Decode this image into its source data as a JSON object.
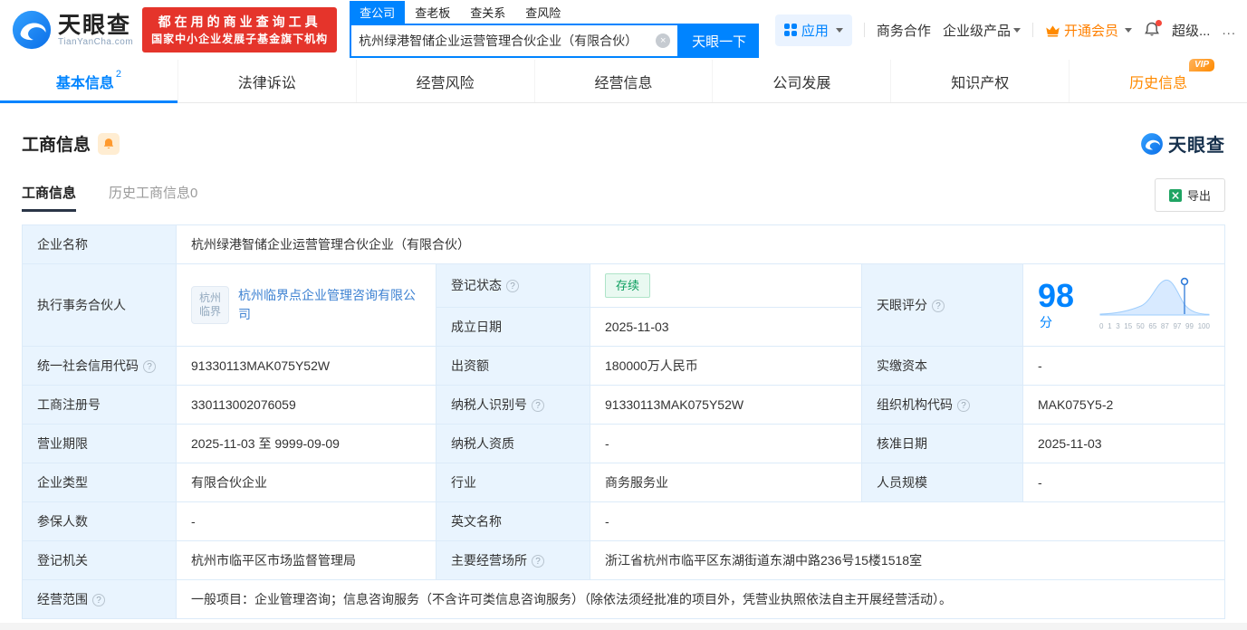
{
  "header": {
    "logo": {
      "title": "天眼查",
      "subtitle": "TianYanCha.com"
    },
    "slogan": {
      "line1": "都在用的商业查询工具",
      "line2": "国家中小企业发展子基金旗下机构"
    },
    "search": {
      "tabs": [
        {
          "label": "查公司"
        },
        {
          "label": "查老板"
        },
        {
          "label": "查关系"
        },
        {
          "label": "查风险"
        }
      ],
      "value": "杭州绿港智储企业运营管理合伙企业（有限合伙）",
      "button": "天眼一下"
    },
    "nav": {
      "apps": "应用",
      "cooperation": "商务合作",
      "enterprise_products": "企业级产品",
      "vip": "开通会员",
      "user": "超级...",
      "more": "..."
    }
  },
  "tabs": {
    "basic": {
      "label": "基本信息",
      "badge": "2"
    },
    "legal": {
      "label": "法律诉讼"
    },
    "risk": {
      "label": "经营风险"
    },
    "operation": {
      "label": "经营信息"
    },
    "development": {
      "label": "公司发展"
    },
    "ip": {
      "label": "知识产权"
    },
    "history": {
      "label": "历史信息",
      "vip_tag": "VIP"
    }
  },
  "section": {
    "title": "工商信息",
    "brand": "天眼查",
    "subtabs": {
      "current": "工商信息",
      "history": "历史工商信息0"
    },
    "export_label": "导出"
  },
  "fields": {
    "company_name": {
      "label": "企业名称",
      "value": "杭州绿港智储企业运营管理合伙企业（有限合伙）"
    },
    "executive_partner": {
      "label": "执行事务合伙人",
      "value": "杭州临界点企业管理咨询有限公司",
      "logo_line1": "杭州",
      "logo_line2": "临界"
    },
    "reg_status": {
      "label": "登记状态",
      "value": "存续"
    },
    "establish_date": {
      "label": "成立日期",
      "value": "2025-11-03"
    },
    "tyc_score": {
      "label": "天眼评分",
      "value": "98",
      "unit": "分",
      "axis": [
        "0",
        "1",
        "3",
        "15",
        "50",
        "65",
        "87",
        "97",
        "99",
        "100"
      ]
    },
    "credit_code": {
      "label": "统一社会信用代码",
      "value": "91330113MAK075Y52W"
    },
    "capital": {
      "label": "出资额",
      "value": "180000万人民币"
    },
    "paid_capital": {
      "label": "实缴资本",
      "value": "-"
    },
    "reg_number": {
      "label": "工商注册号",
      "value": "330113002076059"
    },
    "taxpayer_id": {
      "label": "纳税人识别号",
      "value": "91330113MAK075Y52W"
    },
    "org_code": {
      "label": "组织机构代码",
      "value": "MAK075Y5-2"
    },
    "business_term": {
      "label": "营业期限",
      "value": "2025-11-03 至 9999-09-09"
    },
    "taxpayer_quality": {
      "label": "纳税人资质",
      "value": "-"
    },
    "approval_date": {
      "label": "核准日期",
      "value": "2025-11-03"
    },
    "company_type": {
      "label": "企业类型",
      "value": "有限合伙企业"
    },
    "industry": {
      "label": "行业",
      "value": "商务服务业"
    },
    "staff_size": {
      "label": "人员规模",
      "value": "-"
    },
    "insured_count": {
      "label": "参保人数",
      "value": "-"
    },
    "english_name": {
      "label": "英文名称",
      "value": "-"
    },
    "reg_authority": {
      "label": "登记机关",
      "value": "杭州市临平区市场监督管理局"
    },
    "business_site": {
      "label": "主要经营场所",
      "value": "浙江省杭州市临平区东湖街道东湖中路236号15楼1518室"
    },
    "business_scope": {
      "label": "经营范围",
      "value": "一般项目：企业管理咨询；信息咨询服务（不含许可类信息咨询服务）（除依法须经批准的项目外，凭营业执照依法自主开展经营活动）。"
    }
  },
  "colors": {
    "brand_blue": "#0084ff",
    "brand_red": "#e5342b",
    "vip_orange": "#ff8a00",
    "status_green": "#0b9e5e",
    "label_bg": "#e9f4fe"
  }
}
